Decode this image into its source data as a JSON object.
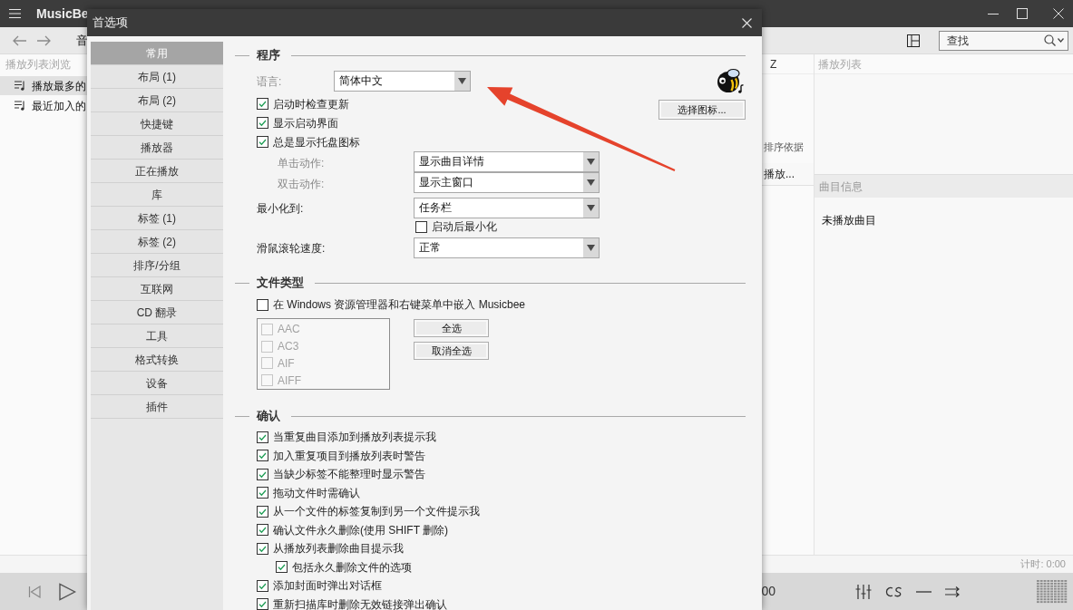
{
  "main_window": {
    "title": "MusicBe",
    "nav_text": "音",
    "search": {
      "placeholder": "查找"
    },
    "playlist_browser": {
      "header": "播放列表浏览",
      "items": [
        {
          "label": "播放最多的",
          "selected": true
        },
        {
          "label": "最近加入的",
          "selected": false
        }
      ]
    },
    "middle_pane": {
      "column_header": "Z",
      "sort_label": "排序依据",
      "row_text": "播放..."
    },
    "playlist_panel": {
      "header": "播放列表"
    },
    "track_info": {
      "header": "曲目信息",
      "text": "未播放曲目"
    },
    "status_bar": {
      "timer": "计时: 0:00"
    },
    "player": {
      "time_text": "00"
    }
  },
  "dialog": {
    "title": "首选项",
    "nav": [
      {
        "label": "常用",
        "selected": true
      },
      {
        "label": "布局 (1)",
        "selected": false
      },
      {
        "label": "布局 (2)",
        "selected": false
      },
      {
        "label": "快捷键",
        "selected": false
      },
      {
        "label": "播放器",
        "selected": false
      },
      {
        "label": "正在播放",
        "selected": false
      },
      {
        "label": "库",
        "selected": false
      },
      {
        "label": "标签 (1)",
        "selected": false
      },
      {
        "label": "标签 (2)",
        "selected": false
      },
      {
        "label": "排序/分组",
        "selected": false
      },
      {
        "label": "互联网",
        "selected": false
      },
      {
        "label": "CD 翻录",
        "selected": false
      },
      {
        "label": "工具",
        "selected": false
      },
      {
        "label": "格式转换",
        "selected": false
      },
      {
        "label": "设备",
        "selected": false
      },
      {
        "label": "插件",
        "selected": false
      }
    ],
    "program": {
      "title": "程序",
      "language": {
        "label": "语言:",
        "value": "简体中文"
      },
      "icon_button": "选择图标...",
      "options": [
        {
          "label": "启动时检查更新",
          "checked": true
        },
        {
          "label": "显示启动界面",
          "checked": true
        },
        {
          "label": "总是显示托盘图标",
          "checked": true
        }
      ],
      "tray_actions": [
        {
          "label": "单击动作:",
          "value": "显示曲目详情"
        },
        {
          "label": "双击动作:",
          "value": "显示主窗口"
        }
      ],
      "minimize_to": {
        "label": "最小化到:",
        "value": "任务栏"
      },
      "start_minimized": {
        "label": "启动后最小化",
        "checked": false
      },
      "wheel_speed": {
        "label": "滑鼠滚轮速度:",
        "value": "正常"
      }
    },
    "file_types": {
      "title": "文件类型",
      "embed": {
        "label": "在 Windows 资源管理器和右键菜单中嵌入 Musicbee",
        "checked": false
      },
      "format_list": {
        "disabled": true,
        "items": [
          {
            "label": "AAC",
            "checked": false
          },
          {
            "label": "AC3",
            "checked": false
          },
          {
            "label": "AIF",
            "checked": false
          },
          {
            "label": "AIFF",
            "checked": false
          }
        ]
      },
      "buttons": [
        "全选",
        "取消全选"
      ]
    },
    "confirm": {
      "title": "确认",
      "options": [
        {
          "label": "当重复曲目添加到播放列表提示我",
          "checked": true
        },
        {
          "label": "加入重复项目到播放列表时警告",
          "checked": true
        },
        {
          "label": "当缺少标签不能整理时显示警告",
          "checked": true
        },
        {
          "label": "拖动文件时需确认",
          "checked": true
        },
        {
          "label": "从一个文件的标签复制到另一个文件提示我",
          "checked": true
        },
        {
          "label": "确认文件永久删除(使用 SHIFT 删除)",
          "checked": true
        },
        {
          "label": "从播放列表删除曲目提示我",
          "checked": true,
          "children": [
            {
              "label": "包括永久删除文件的选项",
              "checked": true
            }
          ]
        },
        {
          "label": "添加封面时弹出对话框",
          "checked": true
        },
        {
          "label": "重新扫描库时删除无效链接弹出确认",
          "checked": true
        }
      ]
    }
  }
}
